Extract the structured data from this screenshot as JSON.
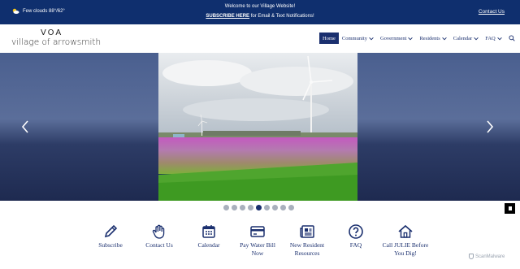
{
  "topbar": {
    "weather": "Few clouds 88°/62°",
    "welcome": "Welcome to our Village Website!",
    "subscribe_link": "SUBSCRIBE HERE",
    "subscribe_rest": " for Email & Text Notifications!",
    "contact": "Contact Us"
  },
  "logo": {
    "mark": "VOA",
    "text": "village of arrowsmith"
  },
  "nav": [
    {
      "label": "Home",
      "dropdown": false
    },
    {
      "label": "Community",
      "dropdown": true
    },
    {
      "label": "Government",
      "dropdown": true
    },
    {
      "label": "Residents",
      "dropdown": true
    },
    {
      "label": "Calendar",
      "dropdown": true
    },
    {
      "label": "FAQ",
      "dropdown": true
    }
  ],
  "slider": {
    "slides": 9,
    "active_slide": 5
  },
  "quick_links": [
    {
      "label": "Subscribe",
      "icon": "pencil-icon"
    },
    {
      "label": "Contact Us",
      "icon": "hand-icon"
    },
    {
      "label": "Calendar",
      "icon": "calendar-icon"
    },
    {
      "label": "Pay Water Bill Now",
      "icon": "credit-card-icon"
    },
    {
      "label": "New Resident Resources",
      "icon": "newspaper-icon"
    },
    {
      "label": "FAQ",
      "icon": "question-icon"
    },
    {
      "label": "Call JULIE Before You Dig!",
      "icon": "house-icon"
    }
  ],
  "badge": "ScanMalware",
  "colors": {
    "navy": "#0f2f6e",
    "nav_text": "#1a2f6e"
  }
}
